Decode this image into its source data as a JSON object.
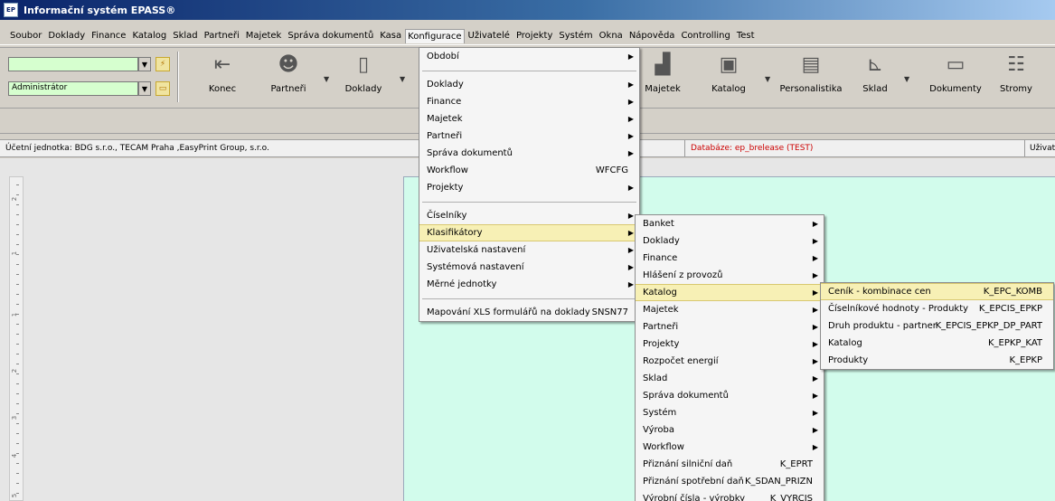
{
  "app": {
    "title": "Informační systém EPASS®",
    "icon_text": "EP"
  },
  "menubar": [
    {
      "label": "Soubor"
    },
    {
      "label": "Doklady"
    },
    {
      "label": "Finance"
    },
    {
      "label": "Katalog"
    },
    {
      "label": "Sklad"
    },
    {
      "label": "Partneři"
    },
    {
      "label": "Majetek"
    },
    {
      "label": "Správa dokumentů"
    },
    {
      "label": "Kasa"
    },
    {
      "label": "Konfigurace",
      "active": true
    },
    {
      "label": "Uživatelé"
    },
    {
      "label": "Projekty"
    },
    {
      "label": "Systém"
    },
    {
      "label": "Okna"
    },
    {
      "label": "Nápověda"
    },
    {
      "label": "Controlling"
    },
    {
      "label": "Test"
    }
  ],
  "toolbar": {
    "combo1_value": "",
    "combo2_value": "Administrátor",
    "tools": [
      {
        "label": "Konec",
        "icon": "exit-door-icon"
      },
      {
        "label": "Partneři",
        "icon": "person-icon"
      },
      {
        "label": "Doklady",
        "icon": "document-icon"
      },
      {
        "label": "Majetek",
        "icon": "factory-icon"
      },
      {
        "label": "Katalog",
        "icon": "catalog-icon"
      },
      {
        "label": "Personalistika",
        "icon": "personnel-icon"
      },
      {
        "label": "Sklad",
        "icon": "forklift-icon"
      },
      {
        "label": "Dokumenty",
        "icon": "documents-icon"
      },
      {
        "label": "Stromy",
        "icon": "tree-icon"
      }
    ]
  },
  "status": {
    "unit": "Účetní jednotka: BDG s.r.o., TECAM Praha ,EasyPrint Group, s.r.o.",
    "db": "Databáze: ep_brelease (TEST)",
    "user": "Uživat"
  },
  "ruler": [
    "2",
    "1",
    "1",
    "2",
    "3",
    "4",
    "5"
  ],
  "konfigurace_menu": [
    {
      "label": "Období",
      "arrow": true
    },
    {
      "sep": true
    },
    {
      "label": "Doklady",
      "arrow": true
    },
    {
      "label": "Finance",
      "arrow": true
    },
    {
      "label": "Majetek",
      "arrow": true
    },
    {
      "label": "Partneři",
      "arrow": true
    },
    {
      "label": "Správa dokumentů",
      "arrow": true
    },
    {
      "label": "Workflow",
      "shortcut": "WFCFG"
    },
    {
      "label": "Projekty",
      "arrow": true
    },
    {
      "sep": true
    },
    {
      "label": "Číselníky",
      "arrow": true
    },
    {
      "label": "Klasifikátory",
      "arrow": true,
      "highlight": true
    },
    {
      "label": "Uživatelská nastavení",
      "arrow": true
    },
    {
      "label": "Systémová nastavení",
      "arrow": true
    },
    {
      "label": "Měrné jednotky",
      "arrow": true
    },
    {
      "sep": true
    },
    {
      "label": "Mapování XLS formulářů na doklady",
      "shortcut": "SNSN77"
    }
  ],
  "klasifikatory_menu": [
    {
      "label": "Banket",
      "arrow": true
    },
    {
      "label": "Doklady",
      "arrow": true
    },
    {
      "label": "Finance",
      "arrow": true
    },
    {
      "label": "Hlášení z provozů",
      "arrow": true
    },
    {
      "label": "Katalog",
      "arrow": true,
      "highlight": true
    },
    {
      "label": "Majetek",
      "arrow": true
    },
    {
      "label": "Partneři",
      "arrow": true
    },
    {
      "label": "Projekty",
      "arrow": true
    },
    {
      "label": "Rozpočet energií",
      "arrow": true
    },
    {
      "label": "Sklad",
      "arrow": true
    },
    {
      "label": "Správa dokumentů",
      "arrow": true
    },
    {
      "label": "Systém",
      "arrow": true
    },
    {
      "label": "Výroba",
      "arrow": true
    },
    {
      "label": "Workflow",
      "arrow": true
    },
    {
      "label": "Přiznání silniční daň",
      "shortcut": "K_EPRT"
    },
    {
      "label": "Přiznání spotřební daň",
      "shortcut": "K_SDAN_PRIZN"
    },
    {
      "label": "Výrobní čísla - výrobky",
      "shortcut": "K_VYRCIS"
    }
  ],
  "katalog_menu": [
    {
      "label": "Ceník - kombinace cen",
      "shortcut": "K_EPC_KOMB",
      "highlight": true
    },
    {
      "label": "Číselníkové hodnoty - Produkty",
      "shortcut": "K_EPCIS_EPKP"
    },
    {
      "label": "Druh produktu - partner",
      "shortcut": "K_EPCIS_EPKP_DP_PART"
    },
    {
      "label": "Katalog",
      "shortcut": "K_EPKP_KAT"
    },
    {
      "label": "Produkty",
      "shortcut": "K_EPKP"
    }
  ]
}
